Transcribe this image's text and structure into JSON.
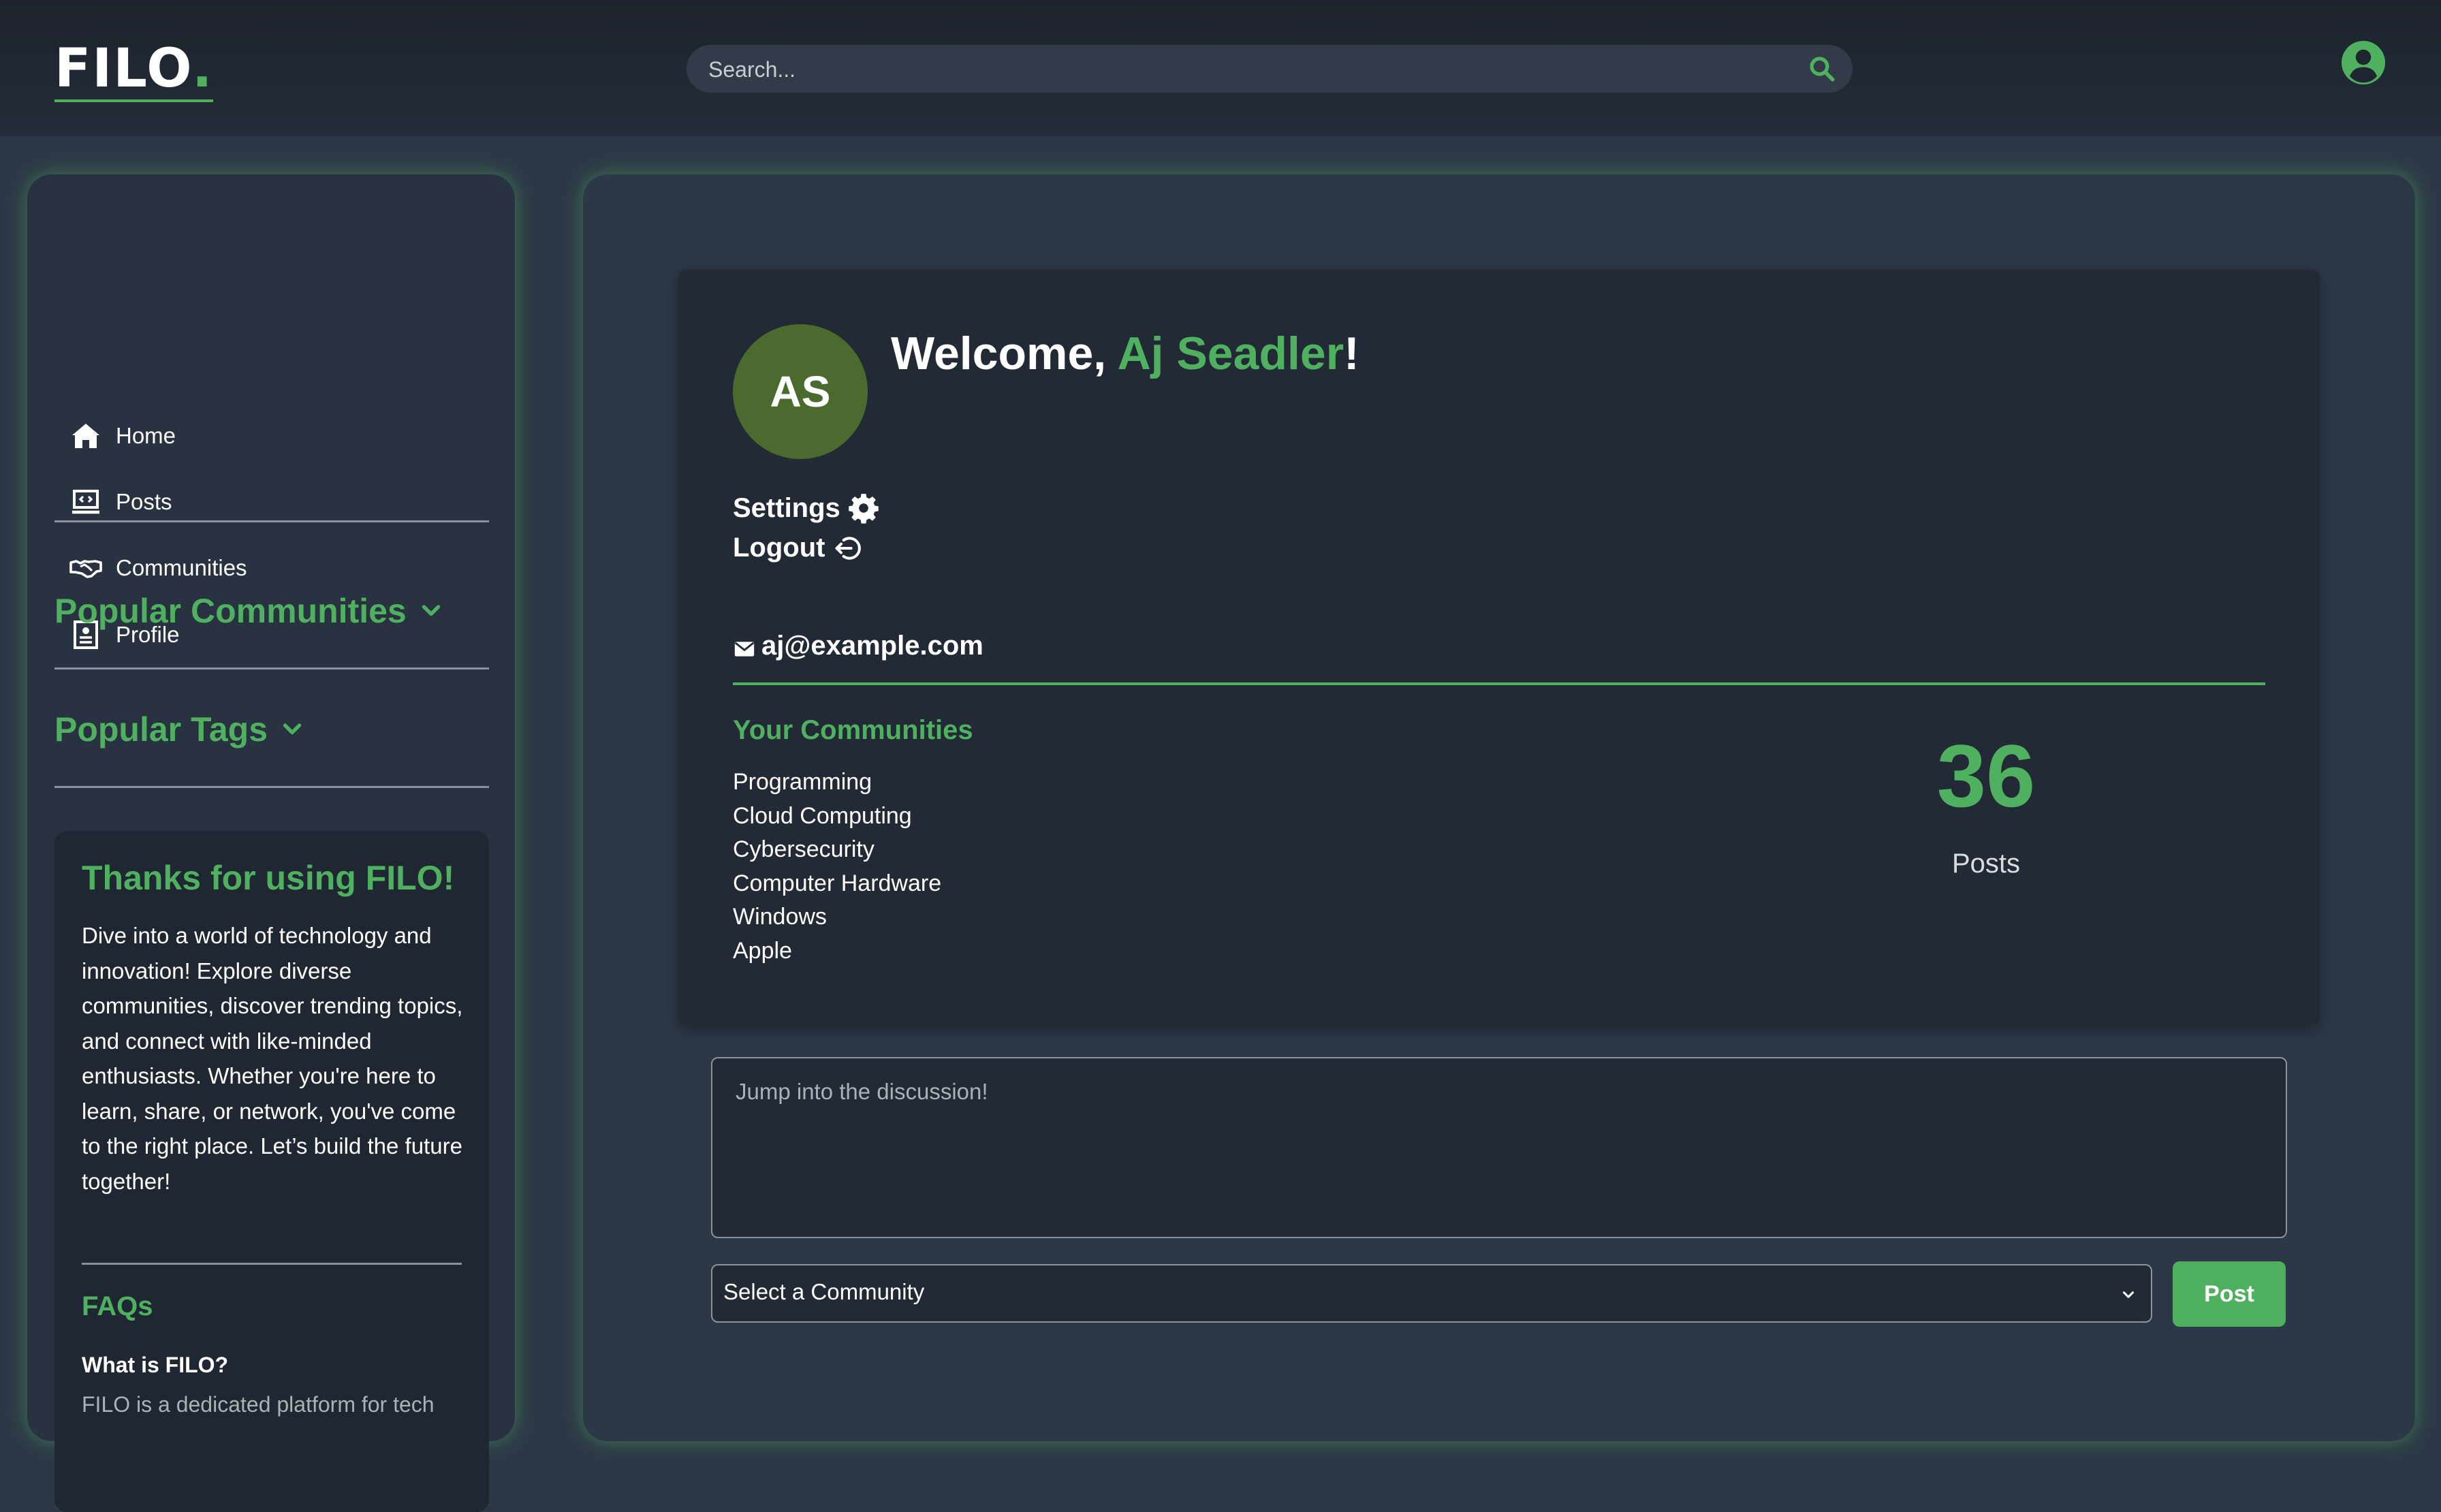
{
  "header": {
    "logo_text": "FILO",
    "logo_dot": ".",
    "search_placeholder": "Search...",
    "search_icon": "search-icon",
    "user_icon": "user-circle-icon"
  },
  "sidebar": {
    "nav": [
      {
        "label": "Home",
        "icon": "home-icon"
      },
      {
        "label": "Posts",
        "icon": "posts-icon"
      },
      {
        "label": "Communities",
        "icon": "handshake-icon"
      },
      {
        "label": "Profile",
        "icon": "profile-icon"
      }
    ],
    "popular_communities": "Popular Communities",
    "popular_tags": "Popular Tags",
    "info": {
      "title": "Thanks for using FILO!",
      "text": "Dive into a world of technology and innovation! Explore diverse communities, discover trending topics, and connect with like-minded enthusiasts. Whether you're here to learn, share, or network, you've come to the right place. Let’s build the future together!",
      "faqs_title": "FAQs",
      "faq_question": "What is FILO?",
      "faq_answer": "FILO is a dedicated platform for tech"
    }
  },
  "profile": {
    "avatar_initials": "AS",
    "welcome_prefix": "Welcome, ",
    "user_name": "Aj Seadler",
    "welcome_suffix": "!",
    "settings_label": "Settings",
    "logout_label": "Logout",
    "email": "aj@example.com",
    "your_communities_title": "Your Communities",
    "communities": [
      "Programming",
      "Cloud Computing",
      "Cybersecurity",
      "Computer Hardware",
      "Windows",
      "Apple"
    ],
    "post_count": "36",
    "post_count_label": "Posts"
  },
  "composer": {
    "placeholder": "Jump into the discussion!",
    "select_value": "Select a Community",
    "post_button": "Post"
  },
  "colors": {
    "accent": "#4fb060",
    "background": "#2d3846",
    "card": "#222a35",
    "avatar": "#4a6a2e"
  }
}
